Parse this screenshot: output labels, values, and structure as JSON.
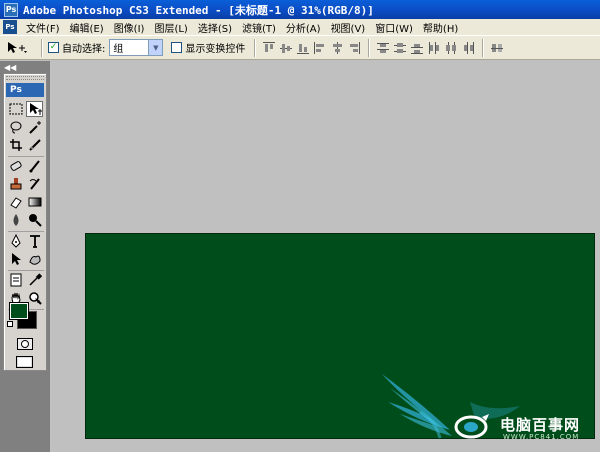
{
  "window": {
    "title": "Adobe Photoshop CS3 Extended - [未标题-1 @ 31%(RGB/8)]",
    "icon": "Ps"
  },
  "menubar": {
    "icon": "Ps",
    "items": [
      "文件(F)",
      "编辑(E)",
      "图像(I)",
      "图层(L)",
      "选择(S)",
      "滤镜(T)",
      "分析(A)",
      "视图(V)",
      "窗口(W)",
      "帮助(H)"
    ]
  },
  "options": {
    "auto_select_label": "自动选择:",
    "auto_select_checked": true,
    "auto_select_value": "组",
    "show_transform_label": "显示变换控件",
    "show_transform_checked": false
  },
  "toolbox": {
    "logo": "Ps",
    "tools": [
      "marquee-tool",
      "move-tool",
      "lasso-tool",
      "magic-wand-tool",
      "crop-tool",
      "slice-tool",
      "healing-brush-tool",
      "brush-tool",
      "clone-stamp-tool",
      "history-brush-tool",
      "eraser-tool",
      "gradient-tool",
      "blur-tool",
      "dodge-tool",
      "pen-tool",
      "type-tool",
      "path-selection-tool",
      "shape-tool",
      "notes-tool",
      "eyedropper-tool",
      "hand-tool",
      "zoom-tool"
    ]
  },
  "colors": {
    "foreground": "#004d1c",
    "background": "#000000",
    "canvas": "#004d1c",
    "workspace": "#c0c0c0"
  },
  "watermark": {
    "name": "电脑百事网",
    "url": "WWW.PC841.COM"
  }
}
